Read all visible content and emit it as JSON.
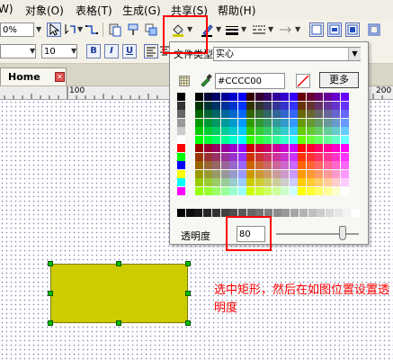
{
  "menubar": {
    "items": [
      "W)",
      "对象(O)",
      "表格(T)",
      "生成(G)",
      "共享(S)",
      "帮助(H)"
    ]
  },
  "toolbar": {
    "zoom_value": "0%",
    "font_size_value": "10",
    "bold_label": "B",
    "italic_label": "I",
    "underline_label": "U"
  },
  "tabs": {
    "home_label": "Home"
  },
  "ruler": {
    "labels": [
      "100",
      "200"
    ]
  },
  "fill_popup": {
    "fill_type_label": "文件类型",
    "fill_type_value": "实心",
    "hex_value": "#CCCC00",
    "more_button": "更多",
    "transparency_label": "透明度",
    "transparency_value": "80",
    "transparency_slider_fraction": 0.8
  },
  "canvas": {
    "rectangle_fill": "#CCCC00",
    "annotation": "选中矩形，然后在如图位置设置透明度",
    "annotation_color": "#FF0000"
  },
  "icons": [
    "select-arrow-icon",
    "connector-icon",
    "paste-icon",
    "fill-bucket-icon",
    "pen-color-icon",
    "line-weight-icon",
    "dash-style-icon",
    "arrow-style-icon",
    "eyedropper-icon",
    "no-fill-icon",
    "close-tab-icon"
  ]
}
